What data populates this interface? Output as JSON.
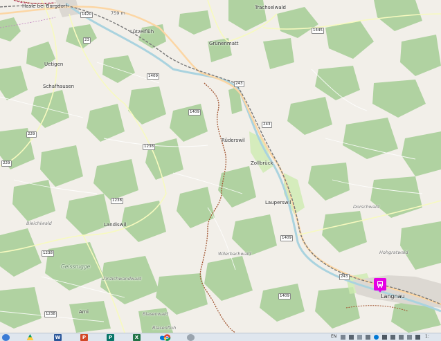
{
  "map": {
    "places": {
      "hasle": "Hasle bei Burgdorf",
      "trachselwald": "Trachselwald",
      "lutzelfluh": "Lützelflüh",
      "grunenmatt": "Grünenmatt",
      "uetigen": "Uetigen",
      "schafhausen": "Schafhausen",
      "ruderswil": "Rüderswil",
      "zollbruck": "Zollbrück",
      "lauperswil": "Lauperswil",
      "landiswil": "Landiswil",
      "arni": "Arni",
      "langnau": "Langnau"
    },
    "areas": {
      "blasenfluh": "Blasenfluh",
      "blasenwald": "Blasenwald",
      "geissrugge": "Geissrugge",
      "bleichiwald": "Bleichiwald",
      "dorschwald": "Dorschwald",
      "hohgratwald": "Hohgratwald",
      "wilerbachwald": "Wilerbachwald",
      "zinzichwandwald": "Zinzichwandwald"
    },
    "elevation": "759 m",
    "roads": {
      "r1420": "1420",
      "r1445": "1445",
      "r23": "23",
      "r1409a": "1409",
      "r1409b": "1409",
      "r1409c": "1409",
      "r1409d": "1409",
      "r243a": "243",
      "r243b": "243",
      "r243c": "243",
      "r229a": "229",
      "r229b": "229",
      "r1238a": "1238",
      "r1238b": "1238",
      "r1238c": "1238",
      "r1238d": "1238"
    },
    "marker": {
      "type": "bus-stop",
      "color": "#e400e4"
    },
    "colors": {
      "background": "#f2efe9",
      "forest": "#add19e",
      "river": "#aad3df",
      "trail": "#a0522d"
    }
  },
  "taskbar": {
    "apps": [
      "windows-start",
      "google-drive",
      "word",
      "powerpoint",
      "publisher",
      "excel",
      "onedrive",
      "chrome",
      "chat"
    ],
    "tray": {
      "lang": "EN",
      "time": "1:"
    }
  }
}
